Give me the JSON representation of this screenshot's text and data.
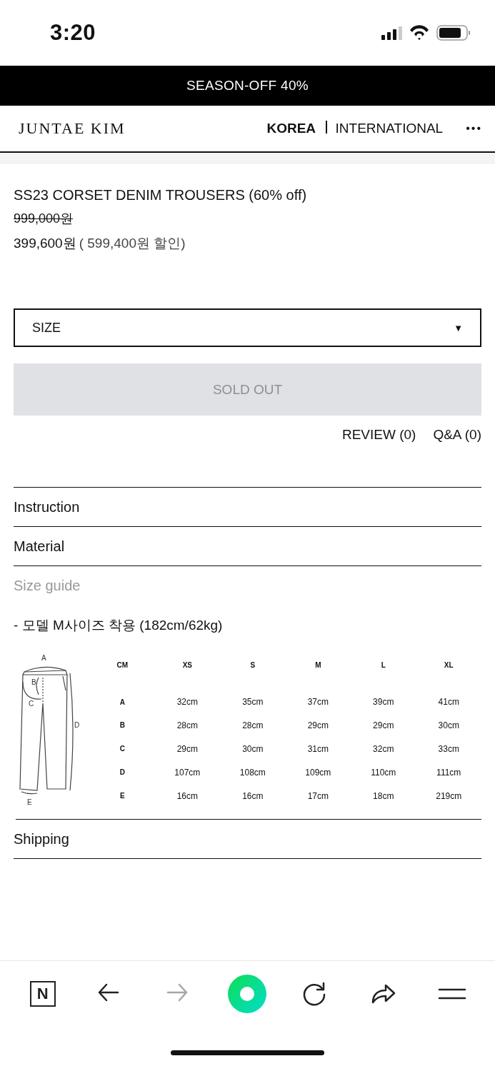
{
  "status_bar": {
    "time": "3:20"
  },
  "banner": {
    "text": "SEASON-OFF 40%"
  },
  "header": {
    "logo": "JUNTAE KIM",
    "regions": [
      {
        "label": "KOREA",
        "selected": true
      },
      {
        "label": "INTERNATIONAL",
        "selected": false
      }
    ],
    "more": "•••"
  },
  "product": {
    "title": "SS23 CORSET DENIM TROUSERS (60% off)",
    "original_price": "999,000원",
    "price": "399,600원",
    "discount": "( 599,400원 할인)",
    "size_select": {
      "placeholder": "SIZE",
      "caret": "▼"
    },
    "buy_button": {
      "label": "SOLD OUT",
      "disabled": true
    },
    "links": [
      "REVIEW (0)",
      "Q&A (0)"
    ]
  },
  "sections": [
    {
      "title": "Instruction",
      "expanded": false
    },
    {
      "title": "Material",
      "expanded": false
    },
    {
      "title": "Size guide",
      "expanded": true,
      "note": "- 모델 M사이즈 착용 (182cm/62kg)",
      "size_chart": {
        "diagram_labels": [
          "A",
          "B",
          "C",
          "D",
          "E"
        ],
        "columns": [
          "CM",
          "XS",
          "S",
          "M",
          "L",
          "XL"
        ],
        "rows": [
          [
            "A",
            "32cm",
            "35cm",
            "37cm",
            "39cm",
            "41cm"
          ],
          [
            "B",
            "28cm",
            "28cm",
            "29cm",
            "29cm",
            "30cm"
          ],
          [
            "C",
            "29cm",
            "30cm",
            "31cm",
            "32cm",
            "33cm"
          ],
          [
            "D",
            "107cm",
            "108cm",
            "109cm",
            "110cm",
            "111cm"
          ],
          [
            "E",
            "16cm",
            "16cm",
            "17cm",
            "18cm",
            "219cm"
          ]
        ]
      }
    },
    {
      "title": "Shipping",
      "expanded": false
    }
  ],
  "toolbar": [
    {
      "kind": "n-logo",
      "label": "N",
      "disabled": false
    },
    {
      "kind": "back",
      "disabled": false
    },
    {
      "kind": "forward",
      "disabled": true
    },
    {
      "kind": "home",
      "disabled": false
    },
    {
      "kind": "reload",
      "disabled": false
    },
    {
      "kind": "share",
      "disabled": false
    },
    {
      "kind": "menu",
      "disabled": false
    }
  ]
}
